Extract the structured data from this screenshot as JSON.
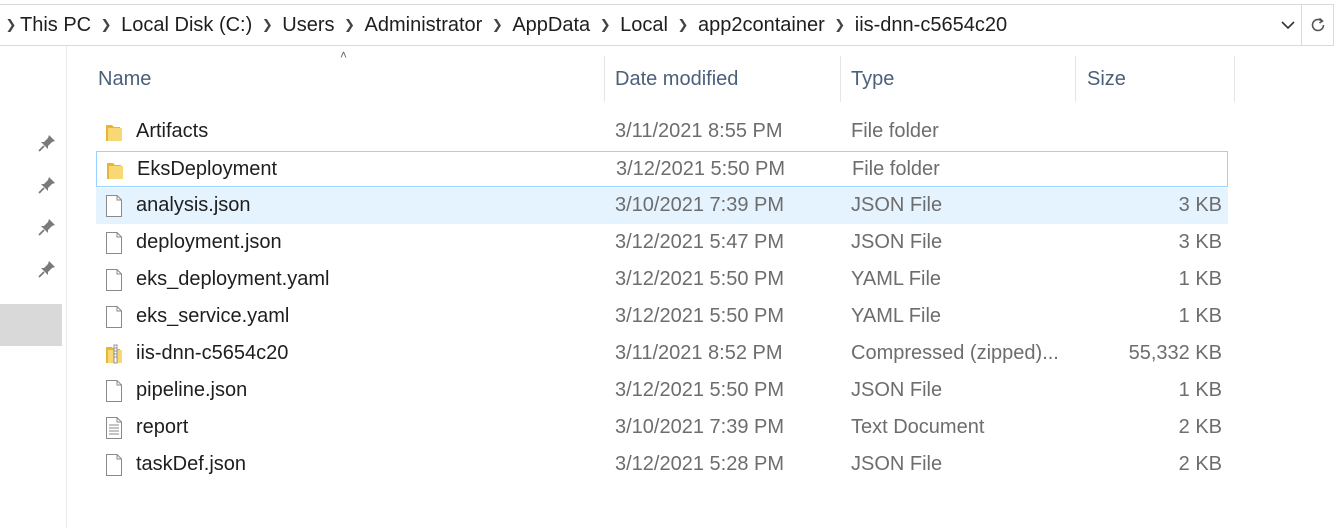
{
  "breadcrumb": [
    "This PC",
    "Local Disk (C:)",
    "Users",
    "Administrator",
    "AppData",
    "Local",
    "app2container",
    "iis-dnn-c5654c20"
  ],
  "columns": {
    "name": "Name",
    "date": "Date modified",
    "type": "Type",
    "size": "Size"
  },
  "files": [
    {
      "name": "Artifacts",
      "date": "3/11/2021 8:55 PM",
      "type": "File folder",
      "size": "",
      "icon": "folder-icon"
    },
    {
      "name": "EksDeployment",
      "date": "3/12/2021 5:50 PM",
      "type": "File folder",
      "size": "",
      "icon": "folder-icon"
    },
    {
      "name": "analysis.json",
      "date": "3/10/2021 7:39 PM",
      "type": "JSON File",
      "size": "3 KB",
      "icon": "file-icon"
    },
    {
      "name": "deployment.json",
      "date": "3/12/2021 5:47 PM",
      "type": "JSON File",
      "size": "3 KB",
      "icon": "file-icon"
    },
    {
      "name": "eks_deployment.yaml",
      "date": "3/12/2021 5:50 PM",
      "type": "YAML File",
      "size": "1 KB",
      "icon": "file-icon"
    },
    {
      "name": "eks_service.yaml",
      "date": "3/12/2021 5:50 PM",
      "type": "YAML File",
      "size": "1 KB",
      "icon": "file-icon"
    },
    {
      "name": "iis-dnn-c5654c20",
      "date": "3/11/2021 8:52 PM",
      "type": "Compressed (zipped)...",
      "size": "55,332 KB",
      "icon": "zip-folder-icon"
    },
    {
      "name": "pipeline.json",
      "date": "3/12/2021 5:50 PM",
      "type": "JSON File",
      "size": "1 KB",
      "icon": "file-icon"
    },
    {
      "name": "report",
      "date": "3/10/2021 7:39 PM",
      "type": "Text Document",
      "size": "2 KB",
      "icon": "text-file-icon"
    },
    {
      "name": "taskDef.json",
      "date": "3/12/2021 5:28 PM",
      "type": "JSON File",
      "size": "2 KB",
      "icon": "file-icon"
    }
  ],
  "colors": {
    "selected_row": "#e5f3ff",
    "focus_border": "#99d1ff",
    "folder_yellow": "#f8d775",
    "header_text": "#4c607a"
  }
}
